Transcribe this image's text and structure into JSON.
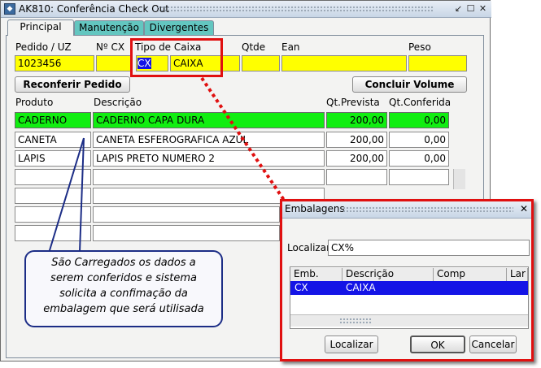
{
  "window": {
    "title": "AK810: Conferência Check Out",
    "min_btn": "_",
    "max_btn": "☐",
    "close_btn": "✕",
    "restore_btn": "↙"
  },
  "tabs": [
    {
      "label": "Principal",
      "active": true
    },
    {
      "label": "Manutenção",
      "active": false
    },
    {
      "label": "Divergentes",
      "active": false
    }
  ],
  "header_fields": {
    "pedido_label": "Pedido / UZ",
    "pedido_value": "1023456",
    "ncx_label": "Nº CX",
    "ncx_value": "",
    "tipo_caixa_label": "Tipo de Caixa",
    "tipo_code": "CX",
    "tipo_desc": "CAIXA",
    "qtde_label": "Qtde",
    "qtde_value": "",
    "ean_label": "Ean",
    "ean_value": "",
    "peso_label": "Peso",
    "peso_value": ""
  },
  "buttons": {
    "reconferir": "Reconferir Pedido",
    "concluir": "Concluir Volume"
  },
  "grid": {
    "headers": {
      "produto": "Produto",
      "descricao": "Descrição",
      "qt_prevista": "Qt.Prevista",
      "qt_conferida": "Qt.Conferida"
    },
    "rows": [
      {
        "produto": "CADERNO",
        "descricao": "CADERNO CAPA DURA",
        "qt_prevista": "200,00",
        "qt_conferida": "0,00",
        "highlight": true
      },
      {
        "produto": "CANETA",
        "descricao": "CANETA ESFEROGRAFICA AZUL",
        "qt_prevista": "200,00",
        "qt_conferida": "0,00",
        "highlight": false
      },
      {
        "produto": "LAPIS",
        "descricao": "LAPIS PRETO NUMERO 2",
        "qt_prevista": "200,00",
        "qt_conferida": "0,00",
        "highlight": false
      }
    ]
  },
  "callout": {
    "text_lines": [
      "São Carregados os dados a",
      "serem conferidos e sistema",
      "solicita a confimação da",
      "embalagem que será utilisada"
    ]
  },
  "dialog": {
    "title": "Embalagens",
    "localizar_label": "Localizar",
    "localizar_value": "CX%",
    "columns": [
      "Emb.",
      "Descrição",
      "Comp",
      "Lar"
    ],
    "rows": [
      {
        "emb": "CX",
        "descricao": "CAIXA"
      }
    ],
    "buttons": {
      "localizar": "Localizar",
      "ok": "OK",
      "cancelar": "Cancelar"
    }
  },
  "colors": {
    "highlight_red": "#e01010",
    "row_green": "#11ee11",
    "field_yellow": "#ffff00",
    "selection_blue": "#1414e6",
    "tab_teal": "#63c6c0"
  }
}
